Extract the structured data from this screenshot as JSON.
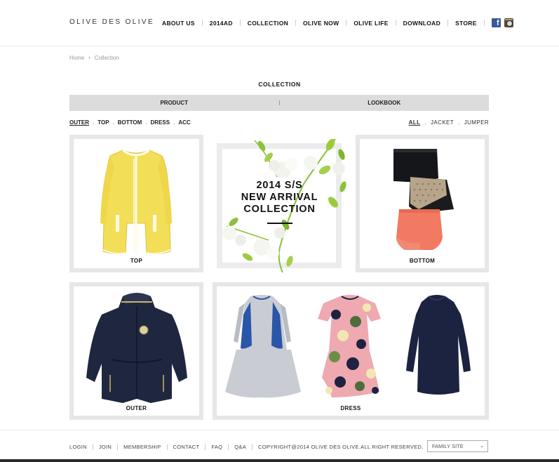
{
  "header": {
    "logo": "OLIVE DES OLIVE",
    "nav": [
      "ABOUT US",
      "2014AD",
      "COLLECTION",
      "OLIVE NOW",
      "OLIVE LIFE",
      "DOWNLOAD",
      "STORE"
    ],
    "social": {
      "facebook": "f",
      "facebook_icon": "facebook-icon",
      "instagram_icon": "instagram-icon"
    }
  },
  "breadcrumb": {
    "home": "Home",
    "separator": "›",
    "current": "Collection"
  },
  "page_title": "COLLECTION",
  "tabs": {
    "product": "PRODUCT",
    "lookbook": "LOOKBOOK"
  },
  "category_filter": {
    "items": [
      "OUTER",
      "TOP",
      "BOTTOM",
      "DRESS",
      "ACC"
    ],
    "active": "OUTER",
    "separator": "."
  },
  "type_filter": {
    "items": [
      "ALL",
      "JACKET",
      "JUMPER"
    ],
    "active": "ALL",
    "separator": "."
  },
  "grid": {
    "top_label": "TOP",
    "promo_line1": "2014 S/S",
    "promo_line2": "NEW ARRIVAL",
    "promo_line3": "COLLECTION",
    "bottom_label": "BOTTOM",
    "outer_label": "OUTER",
    "dress_label": "DRESS"
  },
  "colors": {
    "tile_border": "#e7e7e7",
    "tab_bar": "#dcdcdc",
    "yellow_coat": "#f3de57",
    "navy": "#1f2740",
    "coral": "#f27a62"
  },
  "footer": {
    "links": [
      "LOGIN",
      "JOIN",
      "MEMBERSHIP",
      "CONTACT",
      "FAQ",
      "Q&A"
    ],
    "copyright": "COPYRIGHT@2014 OLIVE DES OLIVE.ALL RIGHT RESERVED.",
    "family_site": "FAMILY SITE",
    "family_site_icon": "chevron-down-icon"
  }
}
